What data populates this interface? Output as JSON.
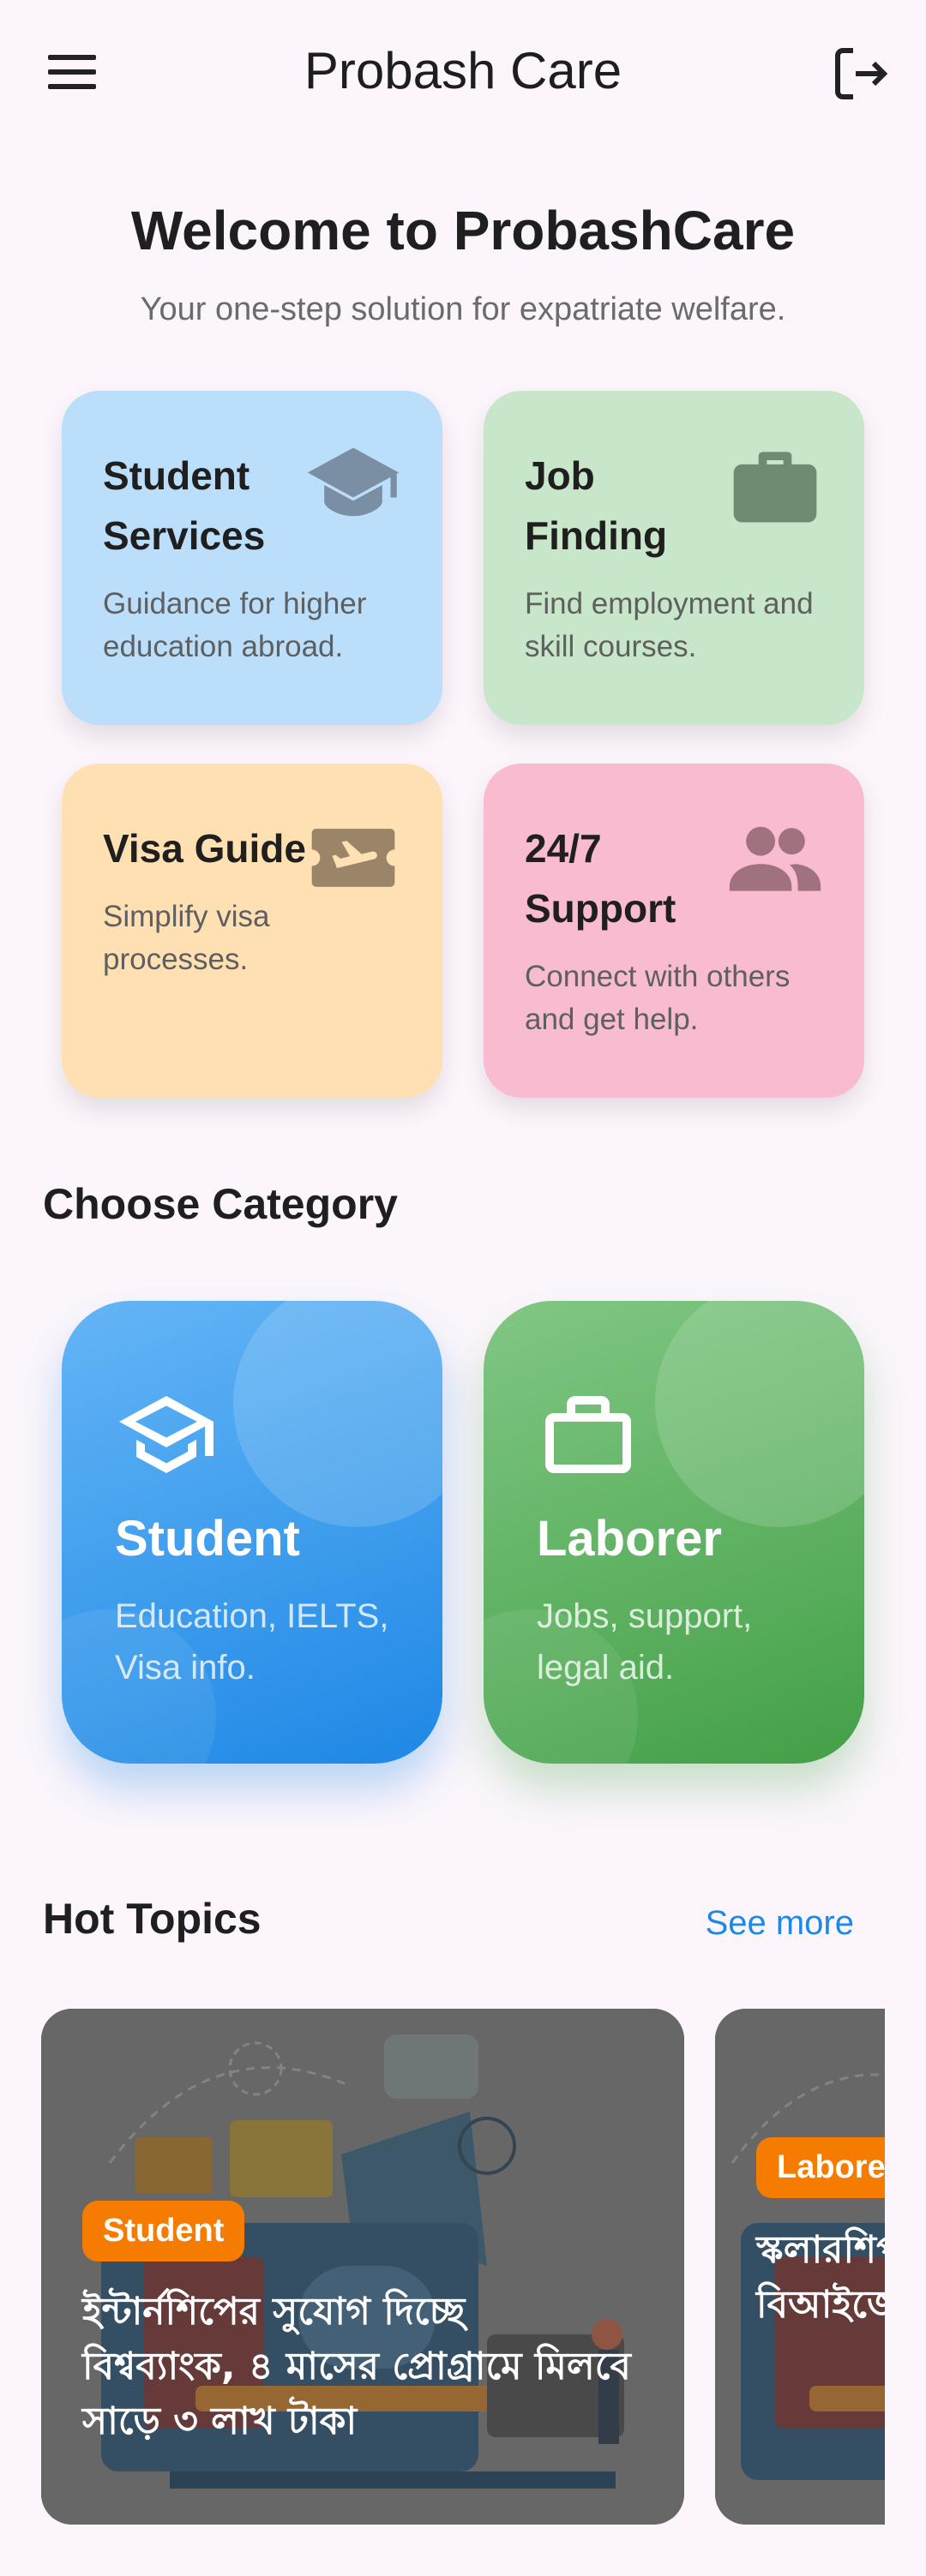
{
  "app": {
    "title": "Probash Care"
  },
  "hero": {
    "title": "Welcome to ProbashCare",
    "subtitle": "Your one-step solution for expatriate welfare."
  },
  "services": [
    {
      "title": "Student Services",
      "desc": "Guidance for higher education abroad.",
      "icon": "graduation-cap-icon",
      "color": "#bbdefb"
    },
    {
      "title": "Job Finding",
      "desc": "Find employment and skill courses.",
      "icon": "briefcase-icon",
      "color": "#c8e6c9"
    },
    {
      "title": "Visa Guide",
      "desc": "Simplify visa processes.",
      "icon": "airplane-ticket-icon",
      "color": "#ffe0b2"
    },
    {
      "title": "24/7 Support",
      "desc": "Connect with others and get help.",
      "icon": "people-icon",
      "color": "#f8bbd0"
    }
  ],
  "categories": {
    "section_title": "Choose Category",
    "items": [
      {
        "title": "Student",
        "desc": "Education, IELTS, Visa info.",
        "icon": "school-icon"
      },
      {
        "title": "Laborer",
        "desc": "Jobs, support, legal aid.",
        "icon": "work-icon"
      }
    ]
  },
  "hot_topics": {
    "section_title": "Hot Topics",
    "see_more": "See more",
    "items": [
      {
        "badge": "Student",
        "headline": "ইন্টার্নশিপের সুযোগ দিচ্ছে বিশ্বব্যাংক, ৪ মাসের প্রোগ্রামে মিলবে সাড়ে ৩ লাখ টাকা"
      },
      {
        "badge": "Laborer",
        "headline": "স্কলারশিপ দিচ্ছে ও বিআইজে কর্মসংস্থান"
      }
    ]
  },
  "colors": {
    "background": "#fcf6fc",
    "accent": "#1e88e5",
    "badge": "#f57c00"
  }
}
